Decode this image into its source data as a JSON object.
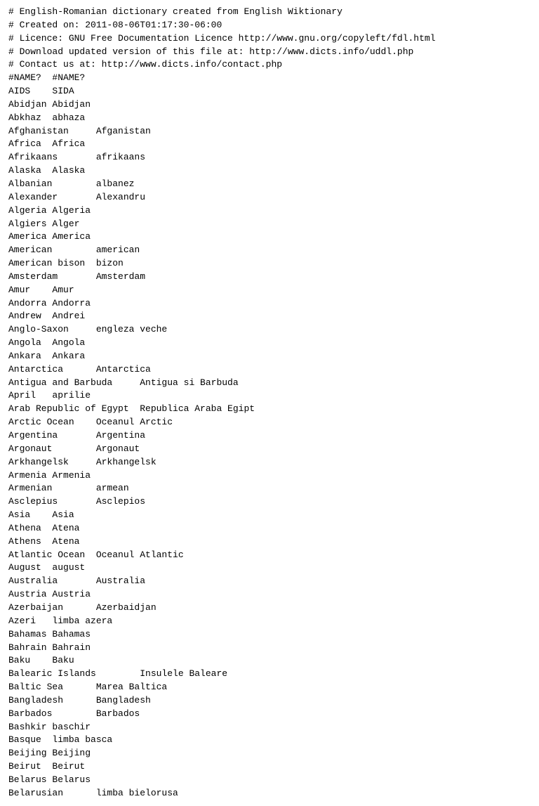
{
  "content": {
    "lines": [
      "# English-Romanian dictionary created from English Wiktionary",
      "# Created on: 2011-08-06T01:17:30-06:00",
      "# Licence: GNU Free Documentation Licence http://www.gnu.org/copyleft/fdl.html",
      "# Download updated version of this file at: http://www.dicts.info/uddl.php",
      "# Contact us at: http://www.dicts.info/contact.php",
      "#NAME?  #NAME?",
      "AIDS    SIDA",
      "Abidjan Abidjan",
      "Abkhaz  abhaza",
      "Afghanistan     Afganistan",
      "Africa  Africa",
      "Afrikaans       afrikaans",
      "Alaska  Alaska",
      "Albanian        albanez",
      "Alexander       Alexandru",
      "Algeria Algeria",
      "Algiers Alger",
      "America America",
      "American        american",
      "American bison  bizon",
      "Amsterdam       Amsterdam",
      "Amur    Amur",
      "Andorra Andorra",
      "Andrew  Andrei",
      "Anglo-Saxon     engleza veche",
      "Angola  Angola",
      "Ankara  Ankara",
      "Antarctica      Antarctica",
      "Antigua and Barbuda     Antigua si Barbuda",
      "April   aprilie",
      "Arab Republic of Egypt  Republica Araba Egipt",
      "Arctic Ocean    Oceanul Arctic",
      "Argentina       Argentina",
      "Argonaut        Argonaut",
      "Arkhangelsk     Arkhangelsk",
      "Armenia Armenia",
      "Armenian        armean",
      "Asclepius       Asclepios",
      "Asia    Asia",
      "Athena  Atena",
      "Athens  Atena",
      "Atlantic Ocean  Oceanul Atlantic",
      "August  august",
      "Australia       Australia",
      "Austria Austria",
      "Azerbaijan      Azerbaidjan",
      "Azeri   limba azera",
      "Bahamas Bahamas",
      "Bahrain Bahrain",
      "Baku    Baku",
      "Balearic Islands        Insulele Baleare",
      "Baltic Sea      Marea Baltica",
      "Bangladesh      Bangladesh",
      "Barbados        Barbados",
      "Bashkir baschir",
      "Basque  limba basca",
      "Beijing Beijing",
      "Beirut  Beirut",
      "Belarus Belarus",
      "Belarusian      limba bielorusa"
    ]
  }
}
